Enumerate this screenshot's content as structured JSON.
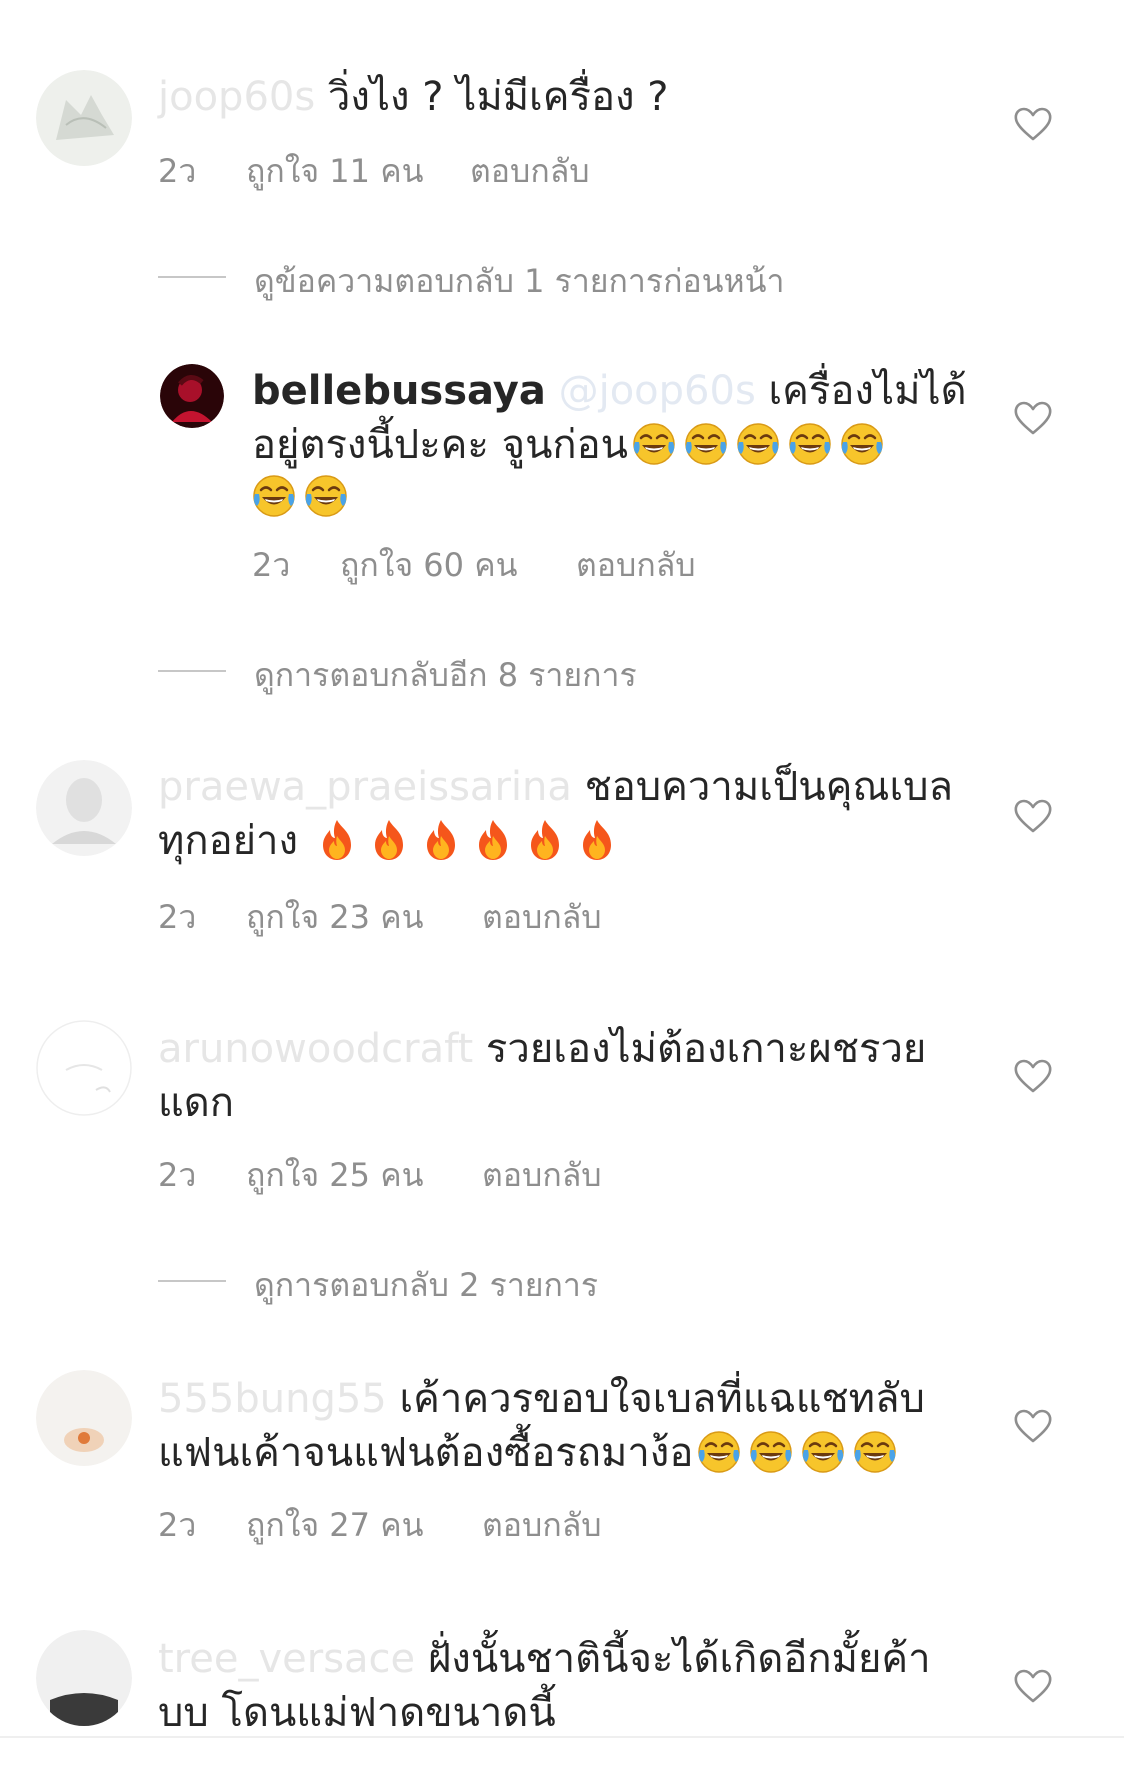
{
  "comments": [
    {
      "username": "joop60s",
      "text": " วิ่งไง ?  ไม่มีเครื่อง ?",
      "time": "2ว",
      "likes": "ถูกใจ 11 คน",
      "reply": "ตอบกลับ",
      "view_replies": "ดูข้อความตอบกลับ 1 รายการก่อนหน้า"
    },
    {
      "username": "bellebussaya",
      "mention": " @joop60s",
      "text_line1": " เครื่องไม่ได้",
      "text_line2": "อยู่ตรงนี้ปะคะ จูนก่อน",
      "time": "2ว",
      "likes": "ถูกใจ 60 คน",
      "reply": "ตอบกลับ",
      "view_replies": "ดูการตอบกลับอีก 8 รายการ"
    },
    {
      "username": "praewa_praeissarina",
      "text_line1": " ชอบความเป็นคุณเบล",
      "text_line2": "ทุกอย่าง ",
      "time": "2ว",
      "likes": "ถูกใจ 23 คน",
      "reply": "ตอบกลับ"
    },
    {
      "username": "arunowoodcraft",
      "text_line1": " รวยเองไม่ต้องเกาะผชรวย",
      "text_line2": "แดก",
      "time": "2ว",
      "likes": "ถูกใจ 25 คน",
      "reply": "ตอบกลับ",
      "view_replies": "ดูการตอบกลับ 2 รายการ"
    },
    {
      "username": "555bung55",
      "text_line1": " เค้าควรขอบใจเบลที่แฉแชทลับ",
      "text_line2": "แฟนเค้าจนแฟนต้องซื้อรถมาง้อ",
      "time": "2ว",
      "likes": "ถูกใจ 27 คน",
      "reply": "ตอบกลับ"
    },
    {
      "username": "tree_versace",
      "text_line1": " ฝั่งนั้นชาตินี้จะได้เกิดอีกมั้ยค้า",
      "text_line2": "บบ  โดนแม่ฟาดขนาดนี้"
    }
  ],
  "icons": {
    "heart": "heart-outline-icon",
    "laugh": "face-with-tears-of-joy-emoji",
    "fire": "fire-emoji"
  },
  "colors": {
    "text": "#262626",
    "secondary": "#8e8e8e",
    "faded_username": "#e6e6e6"
  }
}
